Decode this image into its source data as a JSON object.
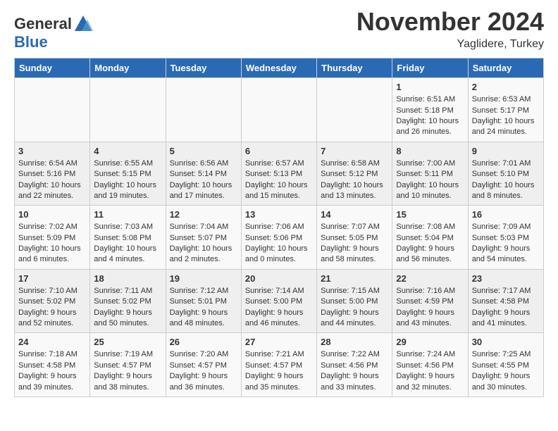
{
  "header": {
    "logo_general": "General",
    "logo_blue": "Blue",
    "month_title": "November 2024",
    "location": "Yaglidere, Turkey"
  },
  "days_of_week": [
    "Sunday",
    "Monday",
    "Tuesday",
    "Wednesday",
    "Thursday",
    "Friday",
    "Saturday"
  ],
  "weeks": [
    [
      {
        "day": "",
        "content": ""
      },
      {
        "day": "",
        "content": ""
      },
      {
        "day": "",
        "content": ""
      },
      {
        "day": "",
        "content": ""
      },
      {
        "day": "",
        "content": ""
      },
      {
        "day": "1",
        "content": "Sunrise: 6:51 AM\nSunset: 5:18 PM\nDaylight: 10 hours and 26 minutes."
      },
      {
        "day": "2",
        "content": "Sunrise: 6:53 AM\nSunset: 5:17 PM\nDaylight: 10 hours and 24 minutes."
      }
    ],
    [
      {
        "day": "3",
        "content": "Sunrise: 6:54 AM\nSunset: 5:16 PM\nDaylight: 10 hours and 22 minutes."
      },
      {
        "day": "4",
        "content": "Sunrise: 6:55 AM\nSunset: 5:15 PM\nDaylight: 10 hours and 19 minutes."
      },
      {
        "day": "5",
        "content": "Sunrise: 6:56 AM\nSunset: 5:14 PM\nDaylight: 10 hours and 17 minutes."
      },
      {
        "day": "6",
        "content": "Sunrise: 6:57 AM\nSunset: 5:13 PM\nDaylight: 10 hours and 15 minutes."
      },
      {
        "day": "7",
        "content": "Sunrise: 6:58 AM\nSunset: 5:12 PM\nDaylight: 10 hours and 13 minutes."
      },
      {
        "day": "8",
        "content": "Sunrise: 7:00 AM\nSunset: 5:11 PM\nDaylight: 10 hours and 10 minutes."
      },
      {
        "day": "9",
        "content": "Sunrise: 7:01 AM\nSunset: 5:10 PM\nDaylight: 10 hours and 8 minutes."
      }
    ],
    [
      {
        "day": "10",
        "content": "Sunrise: 7:02 AM\nSunset: 5:09 PM\nDaylight: 10 hours and 6 minutes."
      },
      {
        "day": "11",
        "content": "Sunrise: 7:03 AM\nSunset: 5:08 PM\nDaylight: 10 hours and 4 minutes."
      },
      {
        "day": "12",
        "content": "Sunrise: 7:04 AM\nSunset: 5:07 PM\nDaylight: 10 hours and 2 minutes."
      },
      {
        "day": "13",
        "content": "Sunrise: 7:06 AM\nSunset: 5:06 PM\nDaylight: 10 hours and 0 minutes."
      },
      {
        "day": "14",
        "content": "Sunrise: 7:07 AM\nSunset: 5:05 PM\nDaylight: 9 hours and 58 minutes."
      },
      {
        "day": "15",
        "content": "Sunrise: 7:08 AM\nSunset: 5:04 PM\nDaylight: 9 hours and 56 minutes."
      },
      {
        "day": "16",
        "content": "Sunrise: 7:09 AM\nSunset: 5:03 PM\nDaylight: 9 hours and 54 minutes."
      }
    ],
    [
      {
        "day": "17",
        "content": "Sunrise: 7:10 AM\nSunset: 5:02 PM\nDaylight: 9 hours and 52 minutes."
      },
      {
        "day": "18",
        "content": "Sunrise: 7:11 AM\nSunset: 5:02 PM\nDaylight: 9 hours and 50 minutes."
      },
      {
        "day": "19",
        "content": "Sunrise: 7:12 AM\nSunset: 5:01 PM\nDaylight: 9 hours and 48 minutes."
      },
      {
        "day": "20",
        "content": "Sunrise: 7:14 AM\nSunset: 5:00 PM\nDaylight: 9 hours and 46 minutes."
      },
      {
        "day": "21",
        "content": "Sunrise: 7:15 AM\nSunset: 5:00 PM\nDaylight: 9 hours and 44 minutes."
      },
      {
        "day": "22",
        "content": "Sunrise: 7:16 AM\nSunset: 4:59 PM\nDaylight: 9 hours and 43 minutes."
      },
      {
        "day": "23",
        "content": "Sunrise: 7:17 AM\nSunset: 4:58 PM\nDaylight: 9 hours and 41 minutes."
      }
    ],
    [
      {
        "day": "24",
        "content": "Sunrise: 7:18 AM\nSunset: 4:58 PM\nDaylight: 9 hours and 39 minutes."
      },
      {
        "day": "25",
        "content": "Sunrise: 7:19 AM\nSunset: 4:57 PM\nDaylight: 9 hours and 38 minutes."
      },
      {
        "day": "26",
        "content": "Sunrise: 7:20 AM\nSunset: 4:57 PM\nDaylight: 9 hours and 36 minutes."
      },
      {
        "day": "27",
        "content": "Sunrise: 7:21 AM\nSunset: 4:57 PM\nDaylight: 9 hours and 35 minutes."
      },
      {
        "day": "28",
        "content": "Sunrise: 7:22 AM\nSunset: 4:56 PM\nDaylight: 9 hours and 33 minutes."
      },
      {
        "day": "29",
        "content": "Sunrise: 7:24 AM\nSunset: 4:56 PM\nDaylight: 9 hours and 32 minutes."
      },
      {
        "day": "30",
        "content": "Sunrise: 7:25 AM\nSunset: 4:55 PM\nDaylight: 9 hours and 30 minutes."
      }
    ]
  ]
}
